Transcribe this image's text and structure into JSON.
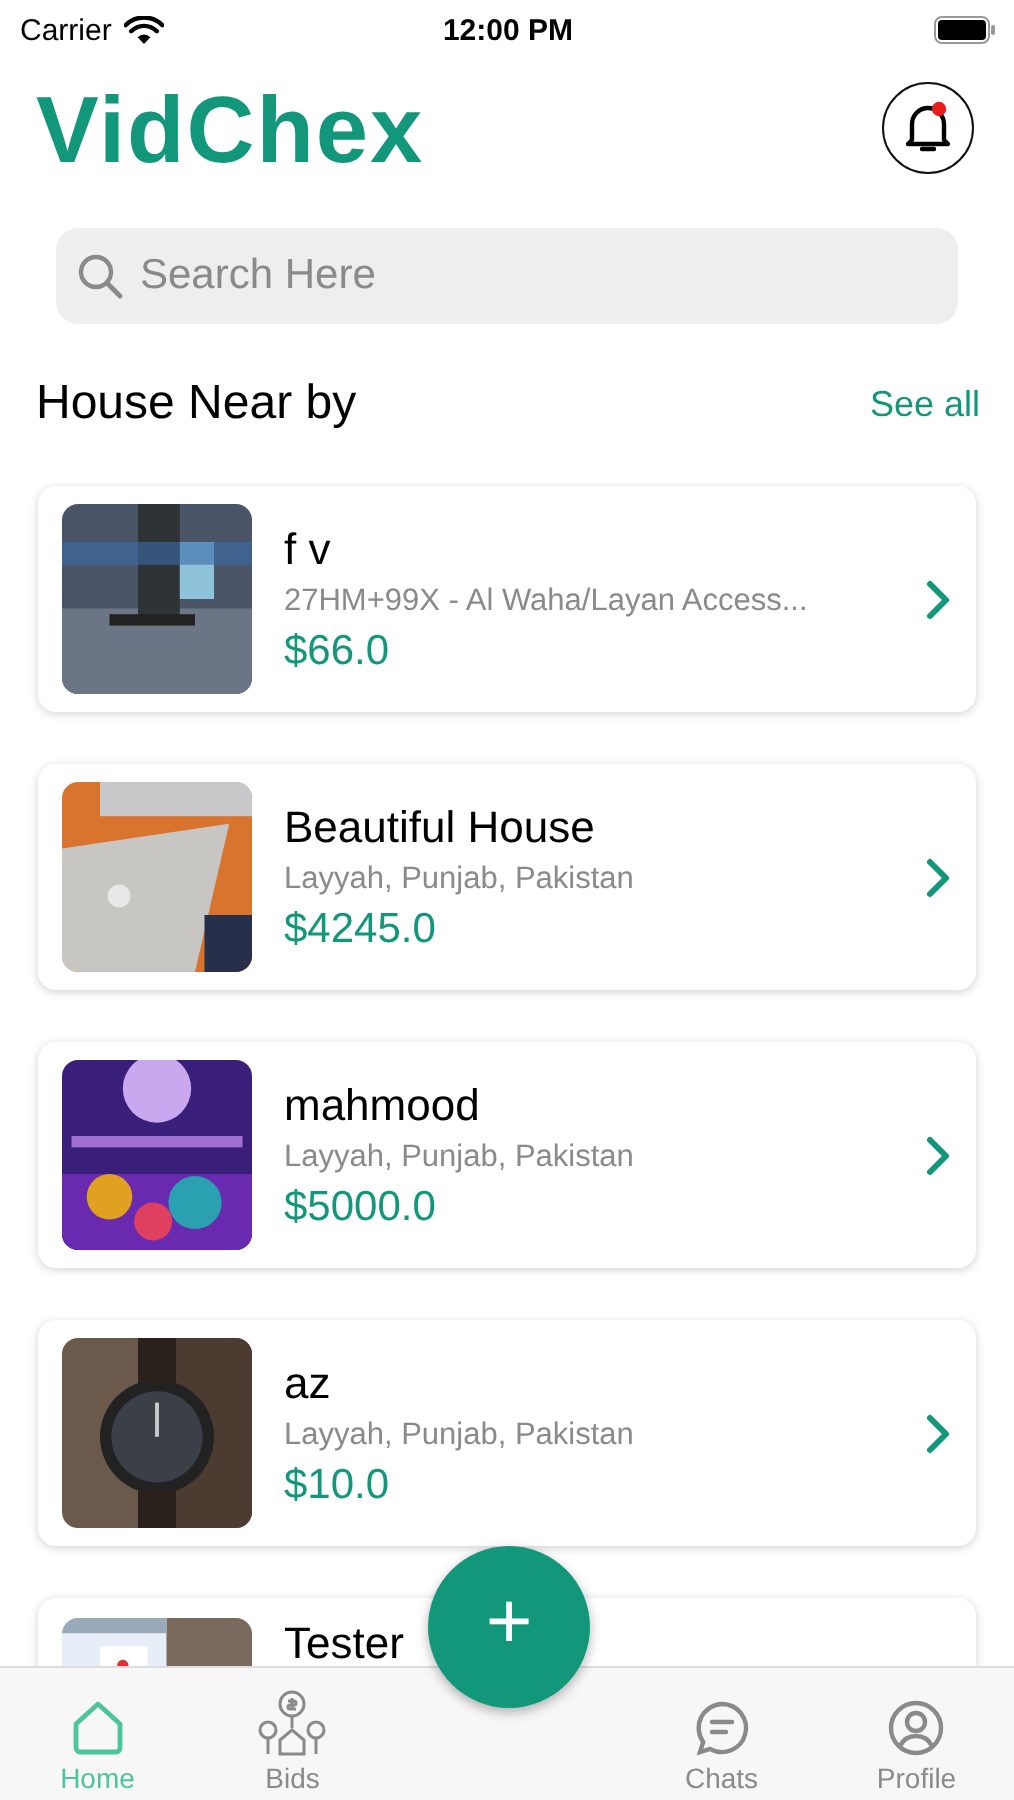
{
  "status_bar": {
    "carrier": "Carrier",
    "time": "12:00 PM"
  },
  "header": {
    "logo": "VidChex",
    "has_notification": true
  },
  "search": {
    "placeholder": "Search Here"
  },
  "section": {
    "title": "House Near by",
    "link": "See all"
  },
  "listings": [
    {
      "title": "f v",
      "address": "27HM+99X - Al Waha/Layan Access...",
      "price": "$66.0"
    },
    {
      "title": "Beautiful House",
      "address": "Layyah, Punjab, Pakistan",
      "price": "$4245.0"
    },
    {
      "title": "mahmood",
      "address": "Layyah, Punjab, Pakistan",
      "price": "$5000.0"
    },
    {
      "title": "az",
      "address": "Layyah, Punjab, Pakistan",
      "price": "$10.0"
    },
    {
      "title": "Tester"
    }
  ],
  "fab": {
    "label": "+"
  },
  "tabs": [
    {
      "label": "Home",
      "kind": "home",
      "selected": true
    },
    {
      "label": "Bids",
      "kind": "bids",
      "selected": false
    },
    {
      "label": "Chats",
      "kind": "chats",
      "selected": false
    },
    {
      "label": "Profile",
      "kind": "profile",
      "selected": false
    }
  ]
}
